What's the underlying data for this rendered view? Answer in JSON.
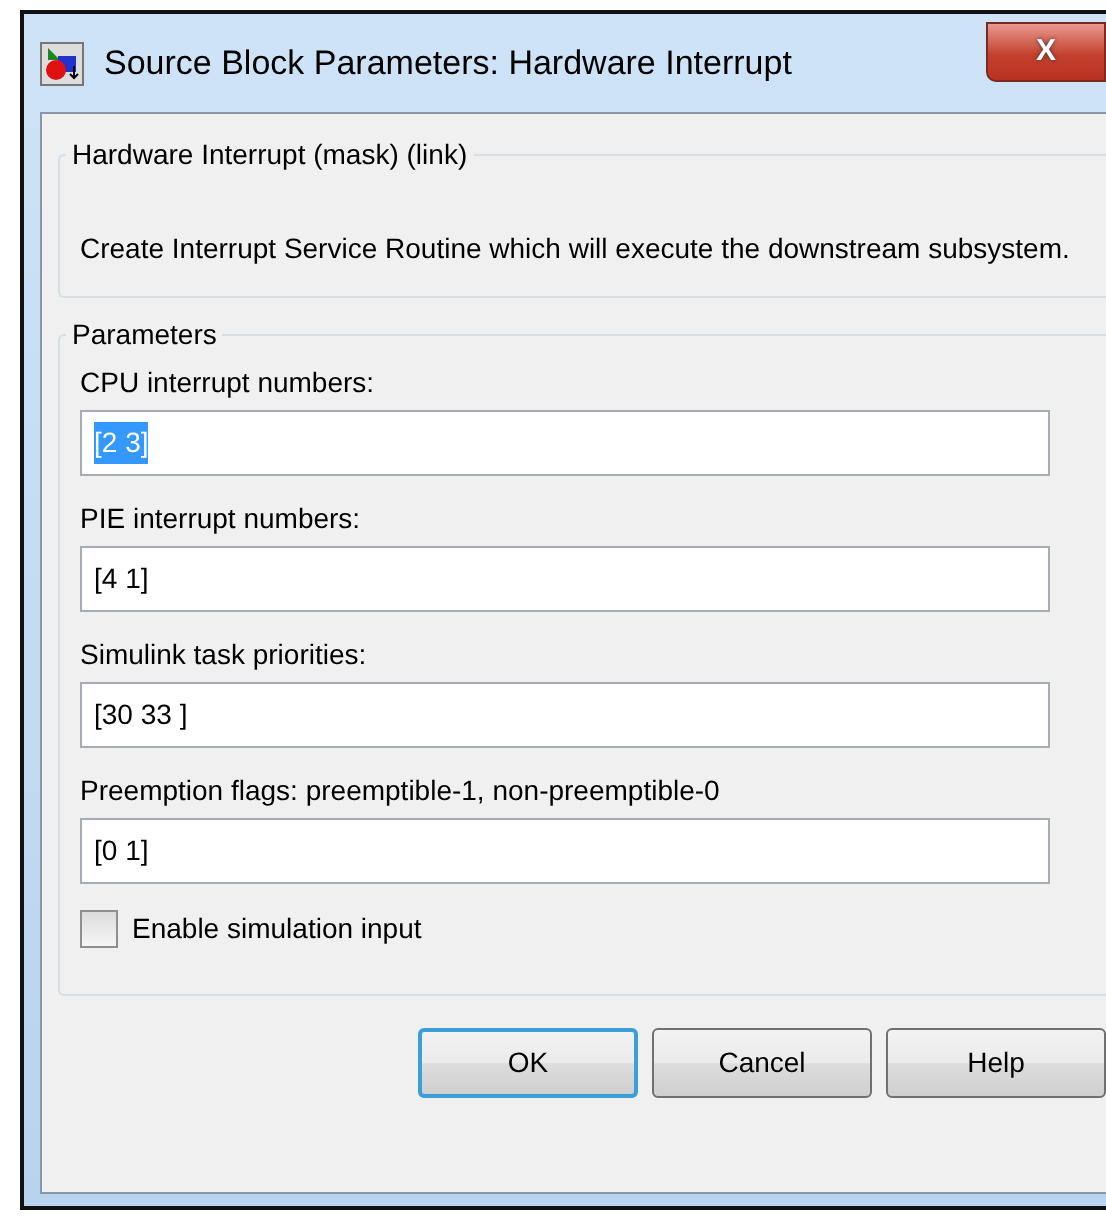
{
  "window": {
    "title": "Source Block Parameters: Hardware Interrupt",
    "close_label": "X"
  },
  "description_group": {
    "legend": "Hardware Interrupt (mask) (link)",
    "text": "Create Interrupt Service Routine which will execute the downstream subsystem."
  },
  "parameters_group": {
    "legend": "Parameters",
    "fields": [
      {
        "label": "CPU interrupt numbers:",
        "value": "[2 3]",
        "selected": true
      },
      {
        "label": "PIE interrupt numbers:",
        "value": "[4 1]",
        "selected": false
      },
      {
        "label": "Simulink task priorities:",
        "value": "[30 33 ]",
        "selected": false
      },
      {
        "label": "Preemption flags: preemptible-1, non-preemptible-0",
        "value": "[0 1]",
        "selected": false
      }
    ],
    "checkbox": {
      "label": "Enable simulation input",
      "checked": false
    }
  },
  "buttons": [
    {
      "label": "OK",
      "default": true
    },
    {
      "label": "Cancel",
      "default": false
    },
    {
      "label": "Help",
      "default": false
    }
  ]
}
